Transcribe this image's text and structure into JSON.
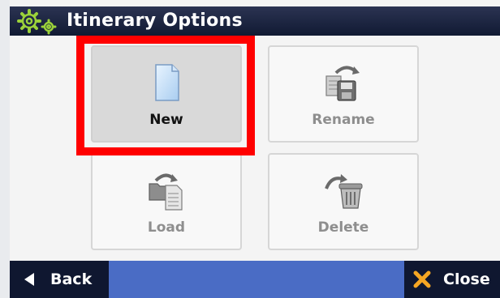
{
  "header": {
    "title": "Itinerary Options",
    "icon": "gears-icon"
  },
  "tiles": [
    {
      "id": "new",
      "label": "New",
      "icon": "new-document-icon",
      "selected": true
    },
    {
      "id": "rename",
      "label": "Rename",
      "icon": "rename-icon",
      "selected": false
    },
    {
      "id": "load",
      "label": "Load",
      "icon": "load-icon",
      "selected": false
    },
    {
      "id": "delete",
      "label": "Delete",
      "icon": "trash-icon",
      "selected": false
    }
  ],
  "footer": {
    "back_label": "Back",
    "close_label": "Close"
  },
  "colors": {
    "header": "#1c2440",
    "footer_bar": "#4a6cc5",
    "footer_button": "#0f1730",
    "highlight": "#ff0000",
    "close_x": "#f5a623"
  }
}
